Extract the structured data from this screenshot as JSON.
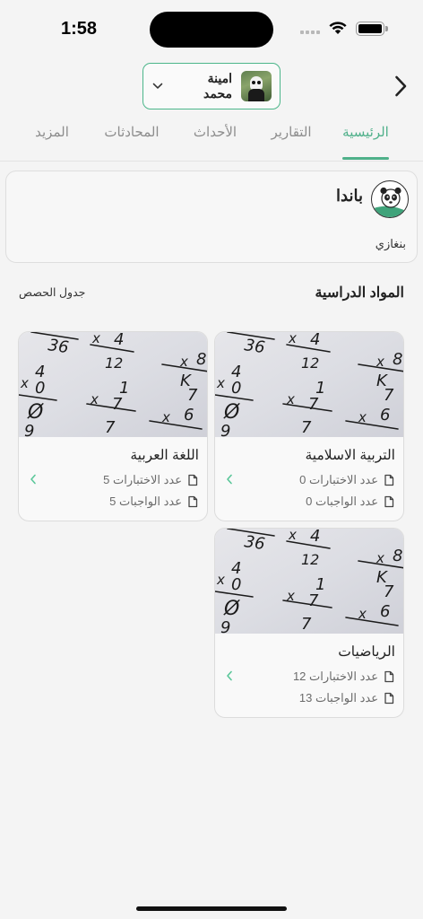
{
  "status_bar": {
    "time": "1:58"
  },
  "header": {
    "student_name": "امينة محمد"
  },
  "tabs": [
    {
      "label": "الرئيسية",
      "active": true
    },
    {
      "label": "التقارير",
      "active": false
    },
    {
      "label": "الأحداث",
      "active": false
    },
    {
      "label": "المحادثات",
      "active": false
    },
    {
      "label": "المزيد",
      "active": false
    }
  ],
  "school": {
    "name": "باندا",
    "city": "بنغازي"
  },
  "subjects_section": {
    "title": "المواد الدراسية",
    "schedule_link": "جدول الحصص"
  },
  "subjects": [
    {
      "title": "التربية الاسلامية",
      "exams": "عدد الاختبارات 0",
      "homework": "عدد الواجبات 0"
    },
    {
      "title": "اللغة العربية",
      "exams": "عدد الاختبارات 5",
      "homework": "عدد الواجبات 5"
    },
    {
      "title": "الرياضيات",
      "exams": "عدد الاختبارات 12",
      "homework": "عدد الواجبات 13"
    }
  ],
  "colors": {
    "accent": "#4fb08a",
    "muted": "#8d8d8d"
  },
  "icons": {
    "back": "chevron-right-icon",
    "dropdown": "chevron-down-icon",
    "stat": "document-icon",
    "card_arrow": "chevron-left-icon"
  }
}
